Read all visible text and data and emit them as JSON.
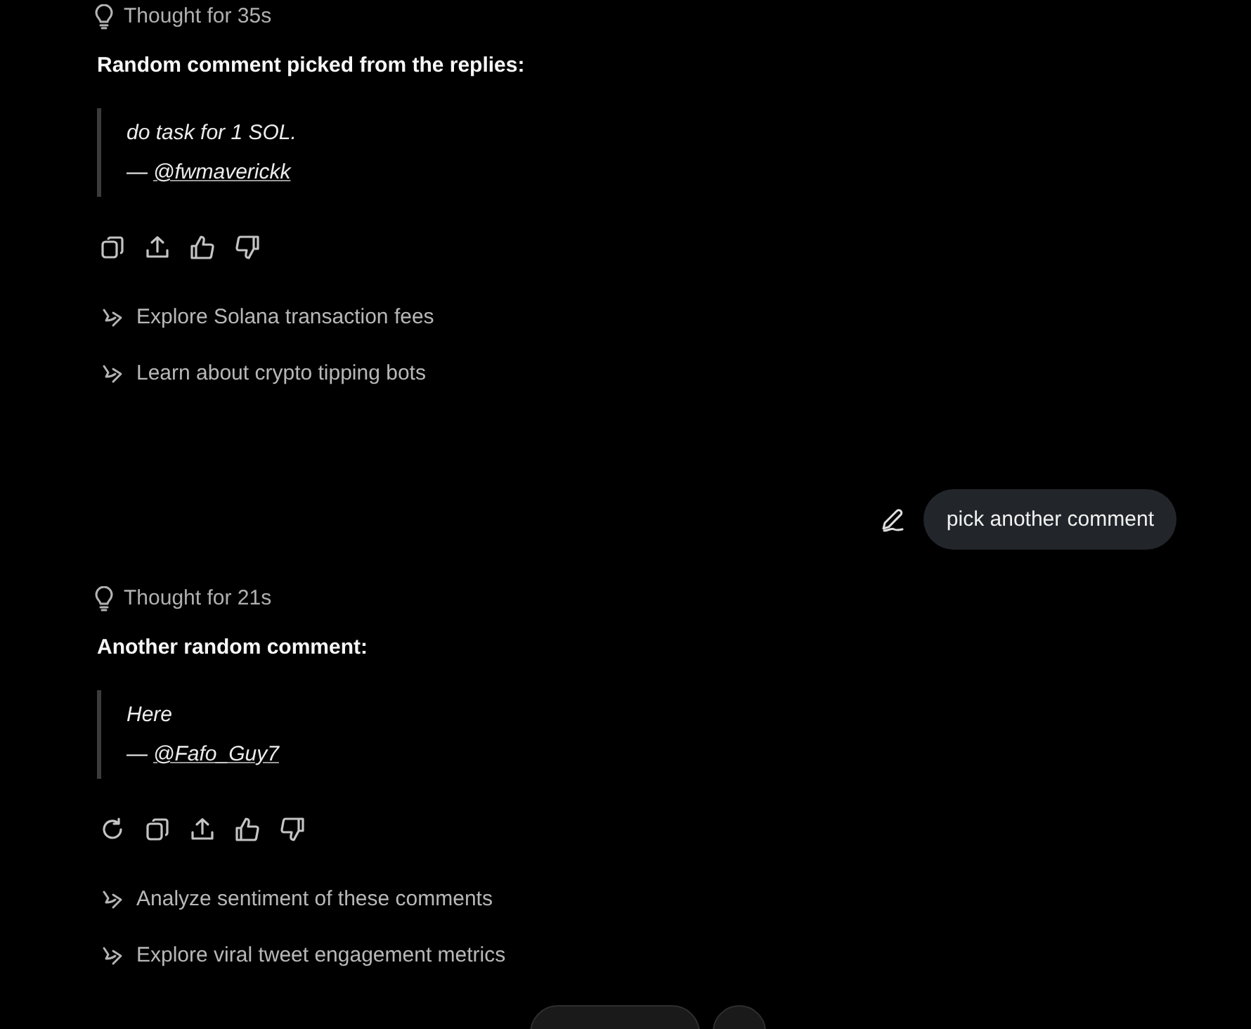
{
  "conversation": [
    {
      "kind": "assistant",
      "thought": "Thought for 35s",
      "heading": "Random comment picked from the replies:",
      "quote": {
        "text": "do task for 1 SOL.",
        "dash": "—",
        "author": "@fwmaverickk"
      },
      "actions": [
        {
          "kind": "copy"
        },
        {
          "kind": "share"
        },
        {
          "kind": "like"
        },
        {
          "kind": "dislike"
        }
      ],
      "suggestions": [
        "Explore Solana transaction fees",
        "Learn about crypto tipping bots"
      ]
    },
    {
      "kind": "user",
      "text": "pick another comment"
    },
    {
      "kind": "assistant",
      "thought": "Thought for 21s",
      "heading": "Another random comment:",
      "quote": {
        "text": "Here",
        "dash": "—",
        "author": "@Fafo_Guy7"
      },
      "actions": [
        {
          "kind": "regenerate"
        },
        {
          "kind": "copy"
        },
        {
          "kind": "share"
        },
        {
          "kind": "like"
        },
        {
          "kind": "dislike"
        }
      ],
      "suggestions": [
        "Analyze sentiment of these comments",
        "Explore viral tweet engagement metrics"
      ]
    }
  ]
}
